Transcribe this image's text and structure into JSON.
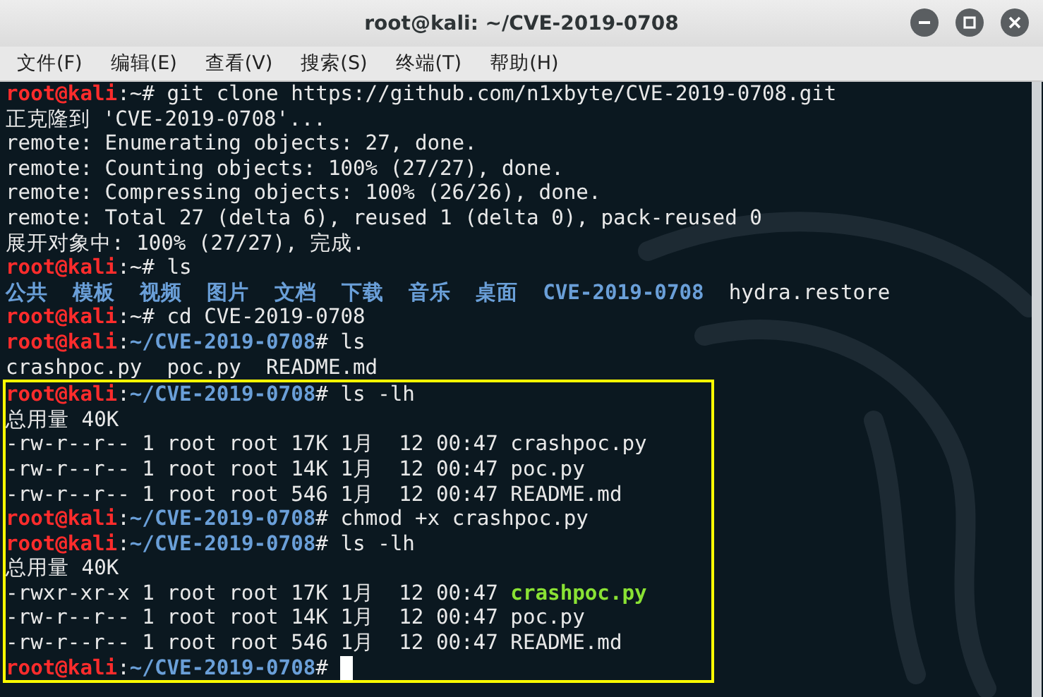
{
  "window": {
    "title": "root@kali: ~/CVE-2019-0708"
  },
  "menu": [
    {
      "label": "文件(F)"
    },
    {
      "label": "编辑(E)"
    },
    {
      "label": "查看(V)"
    },
    {
      "label": "搜索(S)"
    },
    {
      "label": "终端(T)"
    },
    {
      "label": "帮助(H)"
    }
  ],
  "terminal": {
    "lines": [
      {
        "segments": [
          {
            "kind": "user",
            "text": "root@kali"
          },
          {
            "kind": "plain",
            "text": ":~# git clone https://github.com/n1xbyte/CVE-2019-0708.git"
          }
        ]
      },
      {
        "segments": [
          {
            "kind": "plain",
            "text": "正克隆到 'CVE-2019-0708'..."
          }
        ]
      },
      {
        "segments": [
          {
            "kind": "plain",
            "text": "remote: Enumerating objects: 27, done."
          }
        ]
      },
      {
        "segments": [
          {
            "kind": "plain",
            "text": "remote: Counting objects: 100% (27/27), done."
          }
        ]
      },
      {
        "segments": [
          {
            "kind": "plain",
            "text": "remote: Compressing objects: 100% (26/26), done."
          }
        ]
      },
      {
        "segments": [
          {
            "kind": "plain",
            "text": "remote: Total 27 (delta 6), reused 1 (delta 0), pack-reused 0"
          }
        ]
      },
      {
        "segments": [
          {
            "kind": "plain",
            "text": "展开对象中: 100% (27/27), 完成."
          }
        ]
      },
      {
        "segments": [
          {
            "kind": "user",
            "text": "root@kali"
          },
          {
            "kind": "plain",
            "text": ":~# ls"
          }
        ]
      },
      {
        "segments": [
          {
            "kind": "dir",
            "text": "公共  模板  视频  图片  文档  下载  音乐  桌面  CVE-2019-0708"
          },
          {
            "kind": "plain",
            "text": "  hydra.restore"
          }
        ]
      },
      {
        "segments": [
          {
            "kind": "user",
            "text": "root@kali"
          },
          {
            "kind": "plain",
            "text": ":~# cd CVE-2019-0708"
          }
        ]
      },
      {
        "segments": [
          {
            "kind": "user",
            "text": "root@kali"
          },
          {
            "kind": "plain",
            "text": ":"
          },
          {
            "kind": "dir",
            "text": "~/CVE-2019-0708"
          },
          {
            "kind": "plain",
            "text": "# ls"
          }
        ]
      },
      {
        "segments": [
          {
            "kind": "plain",
            "text": "crashpoc.py  poc.py  README.md"
          }
        ]
      }
    ],
    "highlighted_block": {
      "cursor": true,
      "lines": [
        {
          "segments": [
            {
              "kind": "user",
              "text": "root@kali"
            },
            {
              "kind": "plain",
              "text": ":"
            },
            {
              "kind": "dir",
              "text": "~/CVE-2019-0708"
            },
            {
              "kind": "plain",
              "text": "# ls -lh"
            }
          ]
        },
        {
          "segments": [
            {
              "kind": "plain",
              "text": "总用量 40K"
            }
          ]
        },
        {
          "segments": [
            {
              "kind": "plain",
              "text": "-rw-r--r-- 1 root root 17K 1月  12 00:47 crashpoc.py"
            }
          ]
        },
        {
          "segments": [
            {
              "kind": "plain",
              "text": "-rw-r--r-- 1 root root 14K 1月  12 00:47 poc.py"
            }
          ]
        },
        {
          "segments": [
            {
              "kind": "plain",
              "text": "-rw-r--r-- 1 root root 546 1月  12 00:47 README.md"
            }
          ]
        },
        {
          "segments": [
            {
              "kind": "user",
              "text": "root@kali"
            },
            {
              "kind": "plain",
              "text": ":"
            },
            {
              "kind": "dir",
              "text": "~/CVE-2019-0708"
            },
            {
              "kind": "plain",
              "text": "# chmod +x crashpoc.py"
            }
          ]
        },
        {
          "segments": [
            {
              "kind": "user",
              "text": "root@kali"
            },
            {
              "kind": "plain",
              "text": ":"
            },
            {
              "kind": "dir",
              "text": "~/CVE-2019-0708"
            },
            {
              "kind": "plain",
              "text": "# ls -lh"
            }
          ]
        },
        {
          "segments": [
            {
              "kind": "plain",
              "text": "总用量 40K"
            }
          ]
        },
        {
          "segments": [
            {
              "kind": "plain",
              "text": "-rwxr-xr-x 1 root root 17K 1月  12 00:47 "
            },
            {
              "kind": "exec",
              "text": "crashpoc.py"
            }
          ]
        },
        {
          "segments": [
            {
              "kind": "plain",
              "text": "-rw-r--r-- 1 root root 14K 1月  12 00:47 poc.py"
            }
          ]
        },
        {
          "segments": [
            {
              "kind": "plain",
              "text": "-rw-r--r-- 1 root root 546 1月  12 00:47 README.md"
            }
          ]
        },
        {
          "segments": [
            {
              "kind": "user",
              "text": "root@kali"
            },
            {
              "kind": "plain",
              "text": ":"
            },
            {
              "kind": "dir",
              "text": "~/CVE-2019-0708"
            },
            {
              "kind": "plain",
              "text": "# "
            }
          ]
        }
      ]
    }
  }
}
